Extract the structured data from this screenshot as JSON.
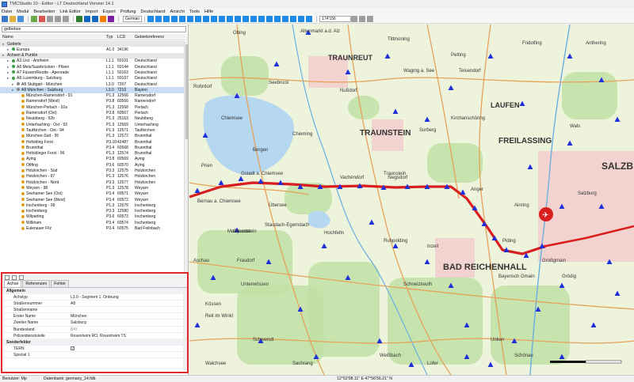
{
  "window": {
    "title": "TMCStudio 10 - Editor - LT Deutschland Version 14.1"
  },
  "menu": [
    "Datei",
    "Modul",
    "Bearbeiten",
    "Link Editor",
    "Import",
    "Export",
    "Prüfung",
    "Deutschland",
    "Ansicht",
    "Tools",
    "Hilfe"
  ],
  "toolbar": {
    "language": "German",
    "zoom": "174'156"
  },
  "search": {
    "value": "gelbebse"
  },
  "grid": {
    "headers": {
      "name": "Name",
      "typ": "Typ",
      "lcd": "LCD",
      "gebiet": "Gebietsreferenz"
    },
    "rows": [
      {
        "name": "Gebiete",
        "typ": "",
        "lcd": "",
        "gebiet": "",
        "kind": "group",
        "indent": 0
      },
      {
        "name": "Europa",
        "typ": "A1.0",
        "lcd": "34196",
        "gebiet": "",
        "kind": "item",
        "indent": 1
      },
      {
        "name": "Achsen & Punkte",
        "typ": "",
        "lcd": "",
        "gebiet": "",
        "kind": "group",
        "indent": 0
      },
      {
        "name": "A3 Linz - Amtheim",
        "typ": "L1.1",
        "lcd": "50101",
        "gebiet": "Deutschland",
        "kind": "item",
        "indent": 1
      },
      {
        "name": "A6 Metz/Saarbrücken - Pilsen",
        "typ": "L1.1",
        "lcd": "50144",
        "gebiet": "Deutschland",
        "kind": "item",
        "indent": 1
      },
      {
        "name": "A7 Füssen/Reutte - Apenrade",
        "typ": "L1.1",
        "lcd": "50163",
        "gebiet": "Deutschland",
        "kind": "item",
        "indent": 1
      },
      {
        "name": "A8 Luxemburg - Salzburg",
        "typ": "L1.1",
        "lcd": "50167",
        "gebiet": "Deutschland",
        "kind": "item",
        "indent": 1
      },
      {
        "name": "A8 Stuttgart - München",
        "typ": "L3.0",
        "lcd": "7207",
        "gebiet": "Deutschland",
        "kind": "item",
        "indent": 2
      },
      {
        "name": "A8 München - Salzburg",
        "typ": "L3.0",
        "lcd": "7210",
        "gebiet": "Bayern",
        "kind": "sel",
        "indent": 2
      },
      {
        "name": "München-Ramersdorf - 91",
        "typ": "P1.3",
        "lcd": "12566",
        "gebiet": "Ramersdorf",
        "kind": "item",
        "indent": 3
      },
      {
        "name": "Ramersdorf (West)",
        "typ": "P3.8",
        "lcd": "60566",
        "gebiet": "Ramersdorf",
        "kind": "item",
        "indent": 3
      },
      {
        "name": "München-Perlach - 92a",
        "typ": "P1.3",
        "lcd": "12568",
        "gebiet": "Perlach",
        "kind": "item",
        "indent": 3
      },
      {
        "name": "Ramersdorf (Ost)",
        "typ": "P3.8",
        "lcd": "60567",
        "gebiet": "Perlach",
        "kind": "item",
        "indent": 3
      },
      {
        "name": "Neubiberg - 92b",
        "typ": "P1.3",
        "lcd": "25163",
        "gebiet": "Neubiberg",
        "kind": "item",
        "indent": 3
      },
      {
        "name": "Unterhaching - Ost - 93",
        "typ": "P1.3",
        "lcd": "12569",
        "gebiet": "Unterhaching",
        "kind": "item",
        "indent": 3
      },
      {
        "name": "Taufkirchen - Ost - 94",
        "typ": "P1.3",
        "lcd": "12571",
        "gebiet": "Taufkirchen",
        "kind": "item",
        "indent": 3
      },
      {
        "name": "München-Süd - 95",
        "typ": "P1.3",
        "lcd": "12572",
        "gebiet": "Brunnthal",
        "kind": "item",
        "indent": 3
      },
      {
        "name": "Hofolding Forst",
        "typ": "P3.10",
        "lcd": "42487",
        "gebiet": "Brunnthal",
        "kind": "item",
        "indent": 3
      },
      {
        "name": "Brunnthal",
        "typ": "P3.4",
        "lcd": "60568",
        "gebiet": "Brunnthal",
        "kind": "item",
        "indent": 3
      },
      {
        "name": "Hofoldinger Forst - 96",
        "typ": "P1.3",
        "lcd": "12574",
        "gebiet": "Brunnthal",
        "kind": "item",
        "indent": 3
      },
      {
        "name": "Aying",
        "typ": "P3.8",
        "lcd": "60569",
        "gebiet": "Aying",
        "kind": "item",
        "indent": 3
      },
      {
        "name": "Ottfing",
        "typ": "P3.6",
        "lcd": "60570",
        "gebiet": "Aying",
        "kind": "item",
        "indent": 3
      },
      {
        "name": "Holzkirchen - Süd",
        "typ": "P3.3",
        "lcd": "12575",
        "gebiet": "Holzkirchen",
        "kind": "item",
        "indent": 3
      },
      {
        "name": "Holzkirchen - 97",
        "typ": "P1.3",
        "lcd": "12576",
        "gebiet": "Holzkirchen",
        "kind": "item",
        "indent": 3
      },
      {
        "name": "Holzkirchen - Nord",
        "typ": "P3.3",
        "lcd": "12577",
        "gebiet": "Holzkirchen",
        "kind": "item",
        "indent": 3
      },
      {
        "name": "Weyarn - 98",
        "typ": "P1.3",
        "lcd": "12578",
        "gebiet": "Weyarn",
        "kind": "item",
        "indent": 3
      },
      {
        "name": "Seehamer See (Ost)",
        "typ": "P3.4",
        "lcd": "60571",
        "gebiet": "Weyarn",
        "kind": "item",
        "indent": 3
      },
      {
        "name": "Seehamer See (West)",
        "typ": "P3.4",
        "lcd": "60572",
        "gebiet": "Weyarn",
        "kind": "item",
        "indent": 3
      },
      {
        "name": "Irschenberg - 99",
        "typ": "P1.3",
        "lcd": "12579",
        "gebiet": "Irschenberg",
        "kind": "item",
        "indent": 3
      },
      {
        "name": "Irschenberg",
        "typ": "P3.3",
        "lcd": "12580",
        "gebiet": "Irschenberg",
        "kind": "item",
        "indent": 3
      },
      {
        "name": "Wilparting",
        "typ": "P3.6",
        "lcd": "60573",
        "gebiet": "Irschenberg",
        "kind": "item",
        "indent": 3
      },
      {
        "name": "Wilkham",
        "typ": "P3.4",
        "lcd": "60574",
        "gebiet": "Irschenberg",
        "kind": "item",
        "indent": 3
      },
      {
        "name": "Eulenauer Filz",
        "typ": "P3.4",
        "lcd": "60575",
        "gebiet": "Bad Feilnbach",
        "kind": "item",
        "indent": 3
      }
    ]
  },
  "props": {
    "tabs": [
      "Achse",
      "Referenzen",
      "Fehler"
    ],
    "rows": [
      {
        "key": "Allgemein",
        "val": "",
        "kind": "cat"
      },
      {
        "key": "Achstyp",
        "val": "L3.0 - Segment 1. Ordnung",
        "kind": "kv"
      },
      {
        "key": "Straßennummer",
        "val": "A8",
        "kind": "kv"
      },
      {
        "key": "Straßenname",
        "val": "",
        "kind": "kv"
      },
      {
        "key": "Erster Name",
        "val": "München",
        "kind": "kv"
      },
      {
        "key": "Zweiter Name",
        "val": "Salzburg",
        "kind": "kv"
      },
      {
        "key": "Bundesland",
        "val": "BAY",
        "kind": "kvgray"
      },
      {
        "key": "Polizeidienststelle",
        "val": "Rosenheim RO, Rosenheim TS",
        "kind": "kv"
      },
      {
        "key": "Sonderfelder",
        "val": "",
        "kind": "cat"
      },
      {
        "key": "TERN",
        "val": "✓",
        "kind": "check"
      },
      {
        "key": "Spezial 1",
        "val": "",
        "kind": "kv"
      }
    ]
  },
  "map": {
    "labels": [
      "Obing",
      "Altenmarkt a.d. Alz",
      "TRAUNREUT",
      "Teisendorf",
      "LAUFEN",
      "Chiemsee",
      "TRAUNSTEIN",
      "Siegsdorf",
      "FREILASSING",
      "SALZB",
      "Bergen",
      "Grassau",
      "BAD REICHENHALL",
      "Ruhpolding",
      "Marquartstein",
      "Unterwössen",
      "Inzell",
      "Reit im Winkl",
      "Schneizlreuth",
      "Anger",
      "Bayerisch Gmain",
      "Schönau",
      "Kössen",
      "Hochfelln",
      "Staudach-Egerndach",
      "Traunstein",
      "Ainring",
      "Piding",
      "Wals",
      "Grödig",
      "Vachendorf",
      "Nußdorf",
      "Chieming",
      "Übersee",
      "Bernau a. Chiemsee",
      "Prien",
      "Gstadt a. Chiemsee",
      "Seebruck",
      "Tittmoning",
      "Waging a. See",
      "Petting",
      "Surberg",
      "Kirchanschöring",
      "Fridolfing",
      "Anthering",
      "Salzburg",
      "Großgmain",
      "Unken",
      "Lofer",
      "Weißbach",
      "Schwendt",
      "Walchsee",
      "Sachrang",
      "Aschau",
      "Frasdorf",
      "Rohrdorf"
    ]
  },
  "status": {
    "user": "Benutzer: Mp",
    "db": "Datenbank: germany_14.fdb",
    "coords": "12°52'08.11\" E   47°56'56.21\" N"
  }
}
